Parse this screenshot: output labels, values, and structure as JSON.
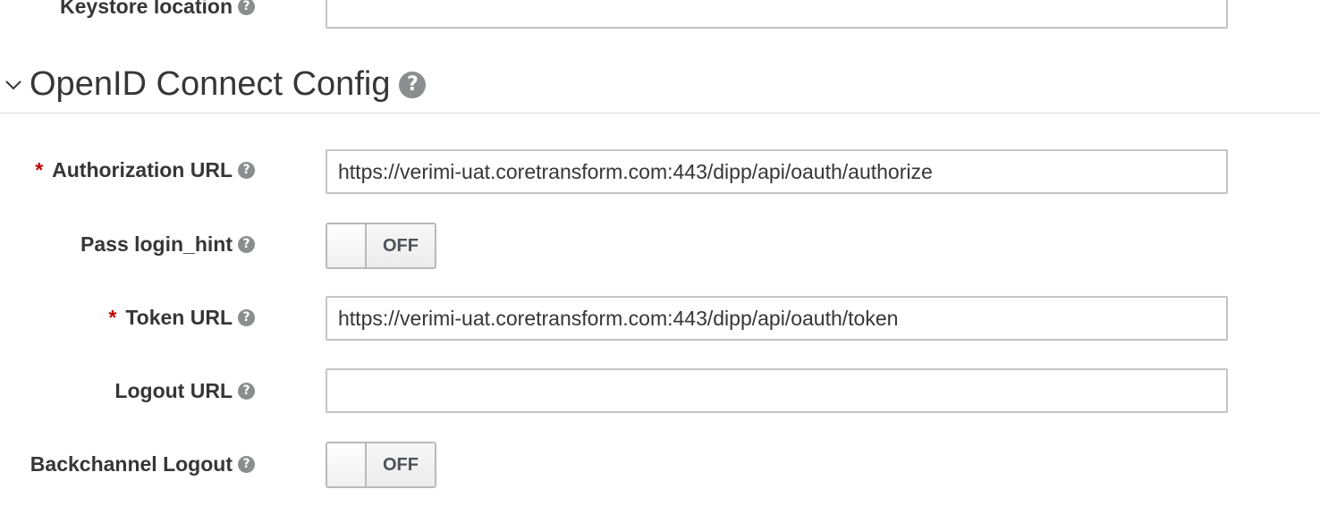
{
  "keystore": {
    "label": "Keystore location",
    "value": ""
  },
  "section": {
    "title": "OpenID Connect Config"
  },
  "fields": {
    "authorization_url": {
      "required_mark": "*",
      "label": "Authorization URL",
      "value": "https://verimi-uat.coretransform.com:443/dipp/api/oauth/authorize"
    },
    "pass_login_hint": {
      "label": "Pass login_hint",
      "state": "OFF"
    },
    "token_url": {
      "required_mark": "*",
      "label": "Token URL",
      "value": "https://verimi-uat.coretransform.com:443/dipp/api/oauth/token"
    },
    "logout_url": {
      "label": "Logout URL",
      "value": ""
    },
    "backchannel_logout": {
      "label": "Backchannel Logout",
      "state": "OFF"
    }
  },
  "icons": {
    "help": "question-circle-icon",
    "collapse": "chevron-down-icon"
  },
  "colors": {
    "required": "#c00000",
    "help_icon": "#8b8d8f",
    "text": "#363636"
  }
}
